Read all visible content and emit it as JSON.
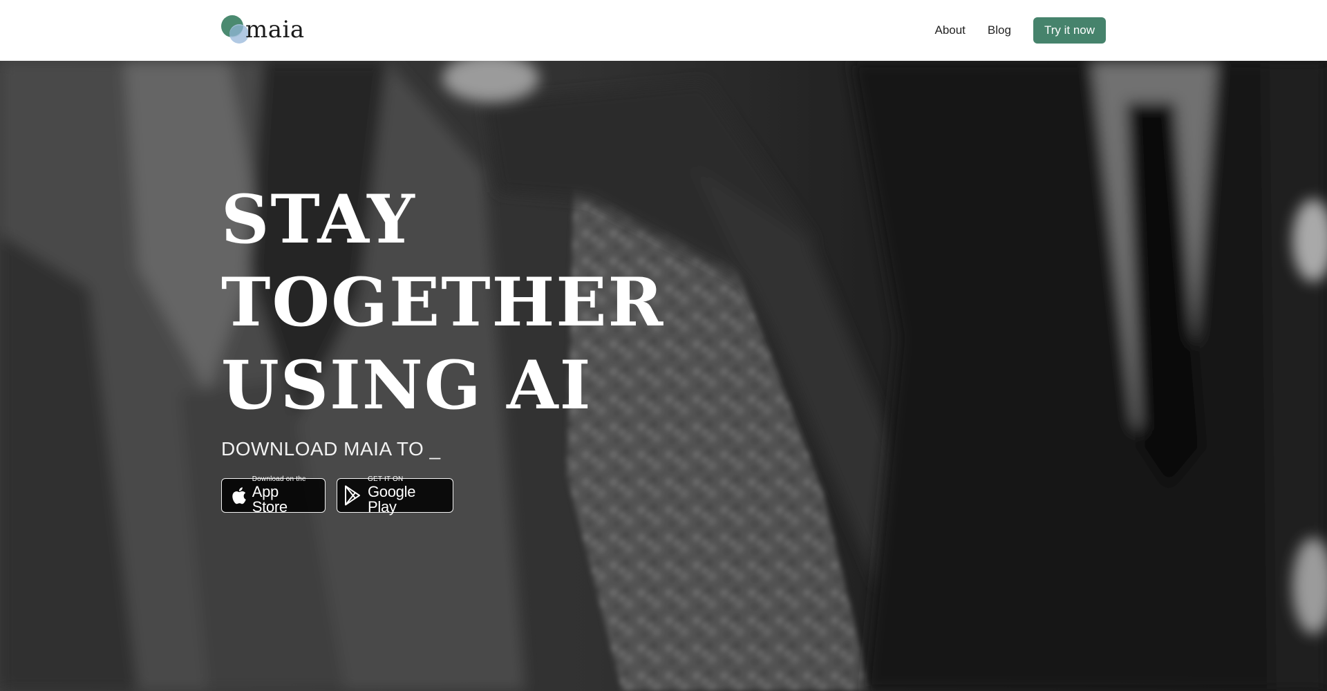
{
  "header": {
    "logo_text": "maia",
    "nav": [
      {
        "label": "About"
      },
      {
        "label": "Blog"
      }
    ],
    "cta_label": "Try it now"
  },
  "colors": {
    "accent": "#46836c",
    "logo_green": "#4b8a70",
    "logo_blue": "#a9c3e0"
  },
  "hero": {
    "title_lines": [
      "STAY",
      "TOGETHER",
      "USING AI"
    ],
    "subtitle": "DOWNLOAD MAIA TO _",
    "badges": {
      "app_store": {
        "small": "Download on the",
        "big": "App Store",
        "icon": "apple-icon"
      },
      "google_play": {
        "small": "GET IT ON",
        "big": "Google Play",
        "icon": "play-store-icon"
      }
    },
    "background_image": "black-and-white blurred photo of people in suits walking"
  }
}
